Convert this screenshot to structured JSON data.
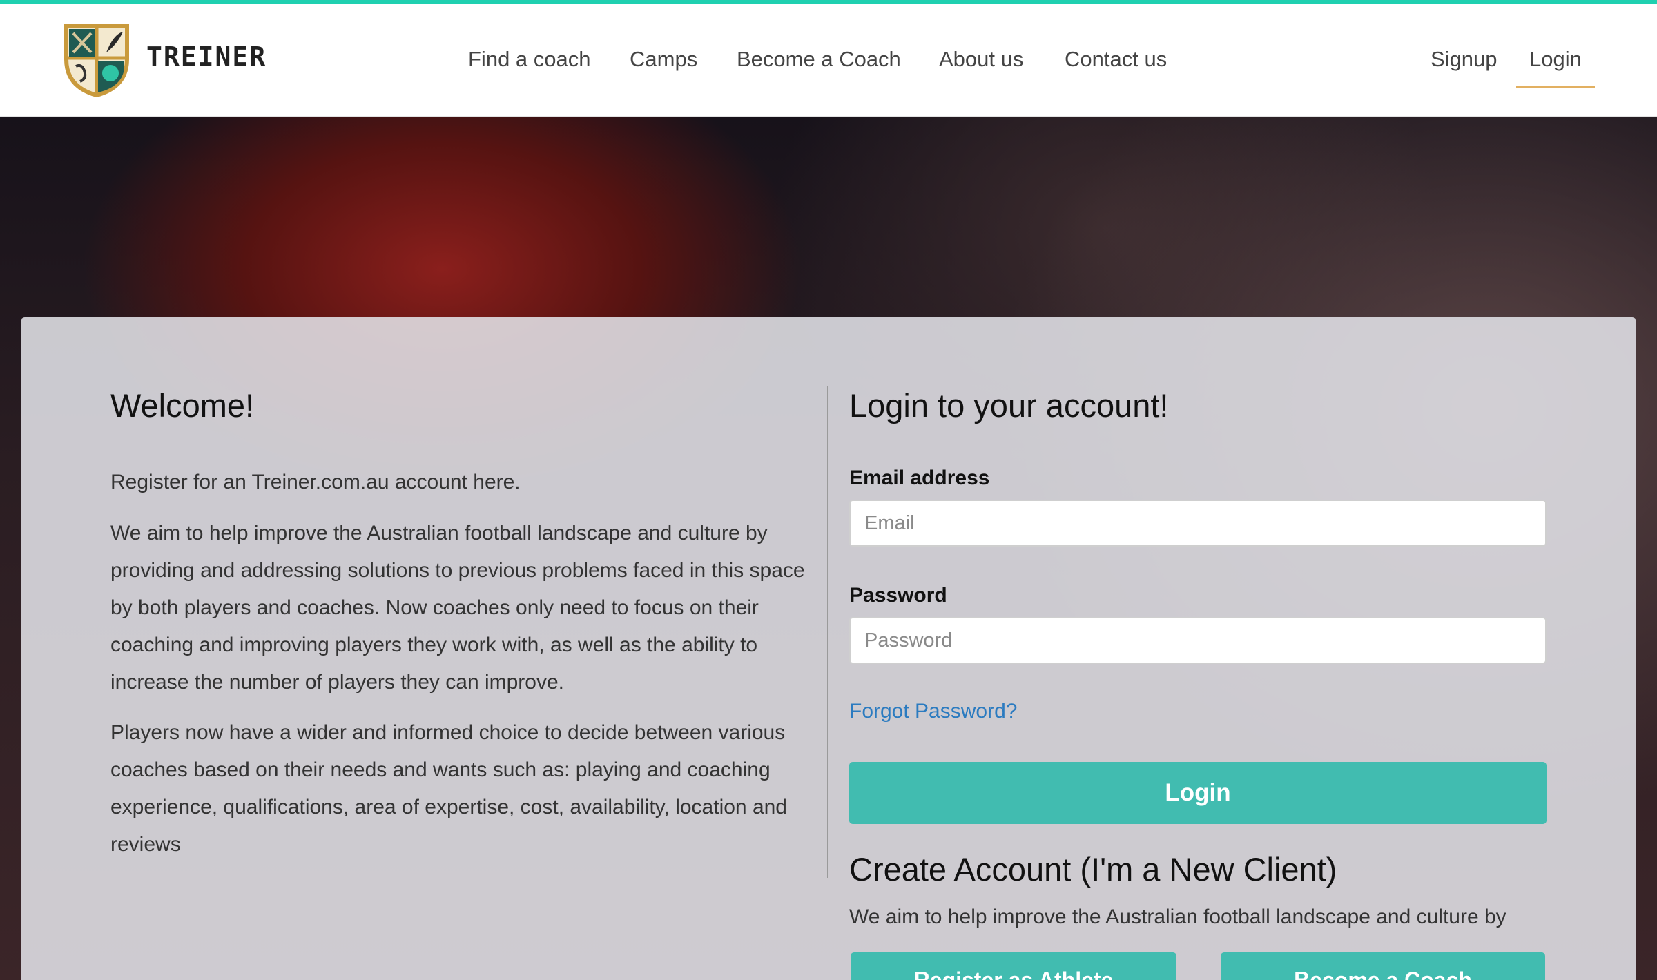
{
  "brand": {
    "name": "TREINER"
  },
  "nav": {
    "items": [
      "Find a coach",
      "Camps",
      "Become a Coach",
      "About us",
      "Contact us"
    ],
    "signup": "Signup",
    "login": "Login"
  },
  "welcome": {
    "title": "Welcome!",
    "intro": "Register for an Treiner.com.au account here.",
    "paragraph1": "We aim to help improve the Australian football landscape and culture by providing and addressing solutions to previous problems faced in this space by both players and coaches. Now coaches only need to focus on their coaching and improving players they work with, as well as the ability to increase the number of players they can improve.",
    "paragraph2": "Players now have a wider and informed choice to decide between various coaches based on their needs and wants such as: playing and coaching experience, qualifications, area of expertise, cost, availability, location and reviews"
  },
  "login_form": {
    "title": "Login to your account!",
    "email_label": "Email address",
    "email_placeholder": "Email",
    "email_value": "",
    "password_label": "Password",
    "password_placeholder": "Password",
    "password_value": "",
    "forgot": "Forgot Password?",
    "submit": "Login"
  },
  "create": {
    "title": "Create Account (I'm a New Client)",
    "text": "We aim to help improve the Australian football landscape and culture by",
    "athlete_button": "Register as Athlete",
    "coach_button": "Become a Coach"
  },
  "colors": {
    "accent": "#41bcb0",
    "topbar": "#1fd0b0",
    "active_underline": "#e2b061",
    "link": "#2b7bc0"
  }
}
